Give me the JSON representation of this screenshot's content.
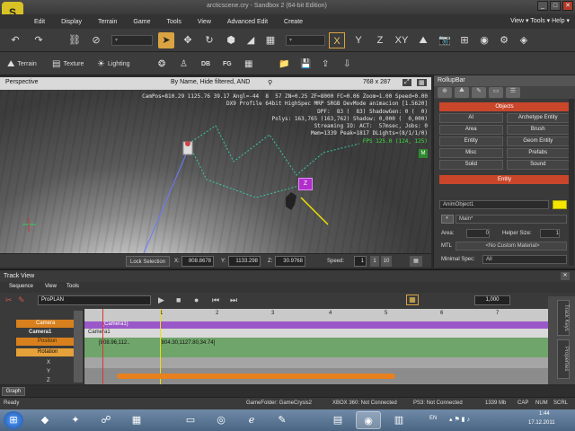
{
  "window": {
    "title": "arcticscene.cry - Sandbox 2 (64-bit Edition)",
    "controls": [
      "_",
      "□",
      "✕"
    ]
  },
  "logo": "S",
  "menu": {
    "items": [
      "Edit",
      "Display",
      "Terrain",
      "Game",
      "Tools",
      "View",
      "Advanced Edit",
      "Create"
    ],
    "right": "View ▾  Tools ▾  Help ▾"
  },
  "toolbar2": {
    "terrain": "Terrain",
    "texture": "Texture",
    "lighting": "Lighting",
    "db": "DB",
    "fg": "FG"
  },
  "viewport": {
    "title": "Perspective",
    "filter": "By Name, Hide filtered, AND",
    "size": "768 x 287",
    "stats": [
      "CamPos=810.29 1125.76 39.17 Angl=-44  8  57 ZN=0.25 ZF=8000 FC=0.06 Zoom=1.00 Speed=0.00",
      "DX9 Profile 64bit HighSpec MRP SRGB DevMode animacion [1.5620]",
      "DPF:  83 (  83) ShadowGen: 0 (  0)",
      "Polys: 163,765 (163,762) Shadow: 0,000 (  0,000)",
      "Streaming IO: ACT:  57msec, Jobs: 0",
      "Mem=1339 Peak=1817 DLights=(8/1/1/0)"
    ],
    "fps": "FPS 125.0 (124, 125)",
    "marker": "M",
    "entity_label": "Z"
  },
  "viewport_bottom": {
    "lock": "Lock Selection",
    "x_label": "X:",
    "x_value": "808.8678",
    "y_label": "Y:",
    "y_value": "1133.298",
    "z_label": "Z:",
    "z_value": "30.9768",
    "speed_label": "Speed:",
    "speed_value": "1",
    "speed_opts": [
      "1",
      "10"
    ]
  },
  "rollup": {
    "title": "RollupBar",
    "objects_header": "Objects",
    "objects": [
      "AI",
      "Archetype Entity",
      "Area",
      "Brush",
      "Entity",
      "Geom Entity",
      "Misc",
      "Prefabs",
      "Solid",
      "Sound"
    ],
    "entity_header": "Entity",
    "entity_name": "AnimObject1",
    "entity_color": "#f5e600",
    "layer": "Main*",
    "area_label": "Area:",
    "area_value": "0",
    "helper_label": "Helper Size:",
    "helper_value": "1",
    "mtl_label": "MTL",
    "mtl_value": "<No Custom Material>",
    "minspec_label": "Minimal Spec:",
    "minspec_value": "All"
  },
  "track": {
    "title": "Track View",
    "menu": [
      "Sequence",
      "View",
      "Tools"
    ],
    "sequence": "ProPLAN",
    "frame": "1,000",
    "tree": [
      "Camera",
      "Camera1",
      "Position",
      "Rotation",
      "X",
      "Y",
      "Z"
    ],
    "ruler": [
      "1",
      "2",
      "3",
      "4",
      "5",
      "6",
      "7"
    ],
    "row_label": "Camera1",
    "row_label2": "(Camera1)",
    "key1": "[808.96,112..",
    "key2": "[804.30,1127.80,34.74]",
    "side_tabs": [
      "Track Keys",
      "Properties"
    ]
  },
  "graph_tab": "Graph",
  "status": {
    "left": "Ready",
    "gamefolder": "GameFolder: GameCrysis2",
    "xbox": "XBOX 360: Not Connected",
    "ps3": "PS3: Not Connected",
    "mem": "1339 Mb",
    "caps": "CAP",
    "num": "NUM",
    "scrl": "SCRL"
  },
  "taskbar": {
    "lang": "EN",
    "time": "1:44",
    "date": "17.12.2011"
  }
}
